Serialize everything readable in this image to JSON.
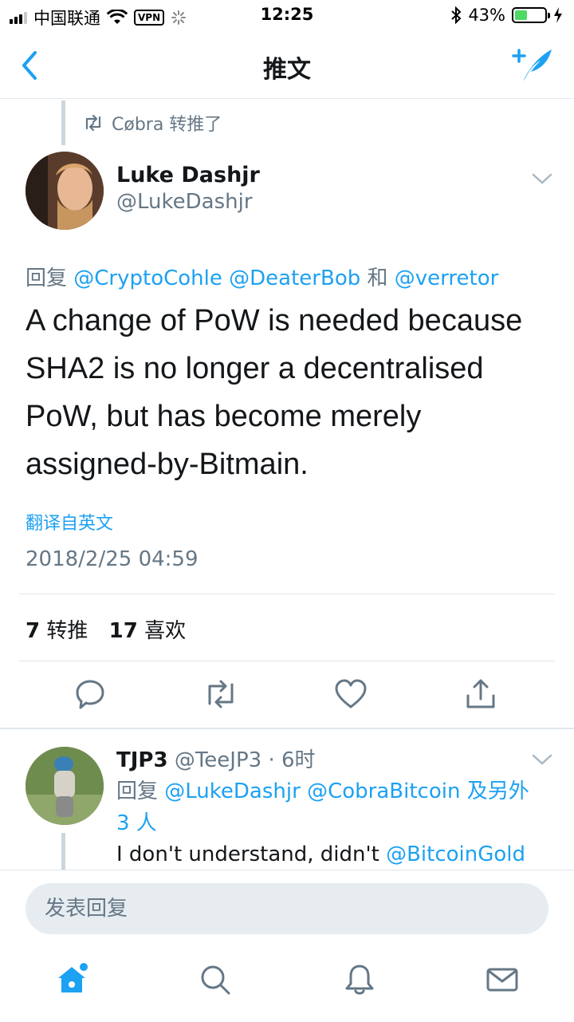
{
  "status_bar": {
    "carrier": "中国联通",
    "vpn": "VPN",
    "time": "12:25",
    "battery": "43%",
    "battery_level": 0.43
  },
  "nav": {
    "title": "推文",
    "back_icon": "chevron-left-icon",
    "compose_icon": "compose-tweet-icon"
  },
  "tweet": {
    "retweeted_by": "Cøbra 转推了",
    "author_name": "Luke Dashjr",
    "author_handle": "@LukeDashjr",
    "reply_prefix": "回复",
    "reply_mentions": [
      "@CryptoCohle",
      "@DeaterBob"
    ],
    "reply_and": "和",
    "reply_last": "@verretor",
    "text": "A change of PoW is needed because SHA2 is no longer a decentralised PoW, but has become merely assigned-by-Bitmain.",
    "translate": "翻译自英文",
    "timestamp": "2018/2/25 04:59",
    "retweets_count": "7",
    "retweets_label": "转推",
    "likes_count": "17",
    "likes_label": "喜欢"
  },
  "reply": {
    "name": "TJP3",
    "handle": "@TeeJP3 · 6时",
    "reply_prefix": "回复",
    "mention1": "@LukeDashjr",
    "mention2": "@CobraBitcoin",
    "others": "及另外 3 人",
    "text_start": "I don't understand, didn't",
    "text_mention": "@BitcoinGold"
  },
  "compose": {
    "placeholder": "发表回复"
  },
  "colors": {
    "accent": "#1da1f2",
    "secondary_text": "#657786",
    "divider": "#e1e8ed"
  }
}
